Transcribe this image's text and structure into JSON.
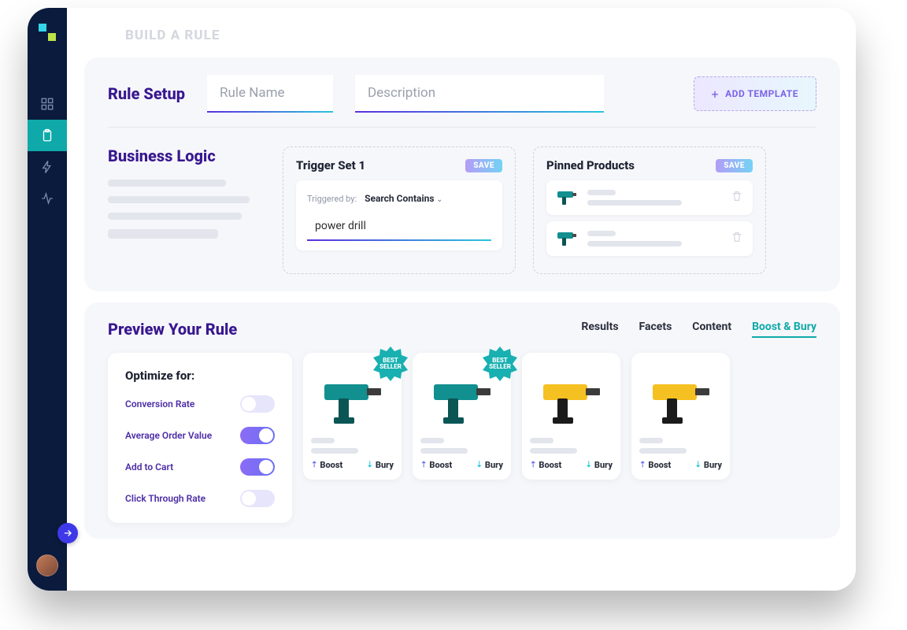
{
  "header": {
    "crumb": "BUILD A RULE"
  },
  "ruleSetup": {
    "heading": "Rule Setup",
    "ruleNamePh": "Rule Name",
    "descriptionPh": "Description",
    "addTemplate": "ADD TEMPLATE"
  },
  "businessLogic": {
    "heading": "Business Logic",
    "trigger": {
      "title": "Trigger Set 1",
      "save": "SAVE",
      "label": "Triggered by:",
      "mode": "Search Contains",
      "value": "power drill"
    },
    "pinned": {
      "title": "Pinned Products",
      "save": "SAVE"
    }
  },
  "preview": {
    "heading": "Preview Your Rule",
    "tabs": {
      "results": "Results",
      "facets": "Facets",
      "content": "Content",
      "boost": "Boost & Bury"
    },
    "optimize": {
      "title": "Optimize for:",
      "rows": {
        "conv": "Conversion Rate",
        "aov": "Average Order Value",
        "atc": "Add to Cart",
        "ctr": "Click Through Rate"
      }
    },
    "badge": "BEST SELLER",
    "boost": "Boost",
    "bury": "Bury"
  }
}
